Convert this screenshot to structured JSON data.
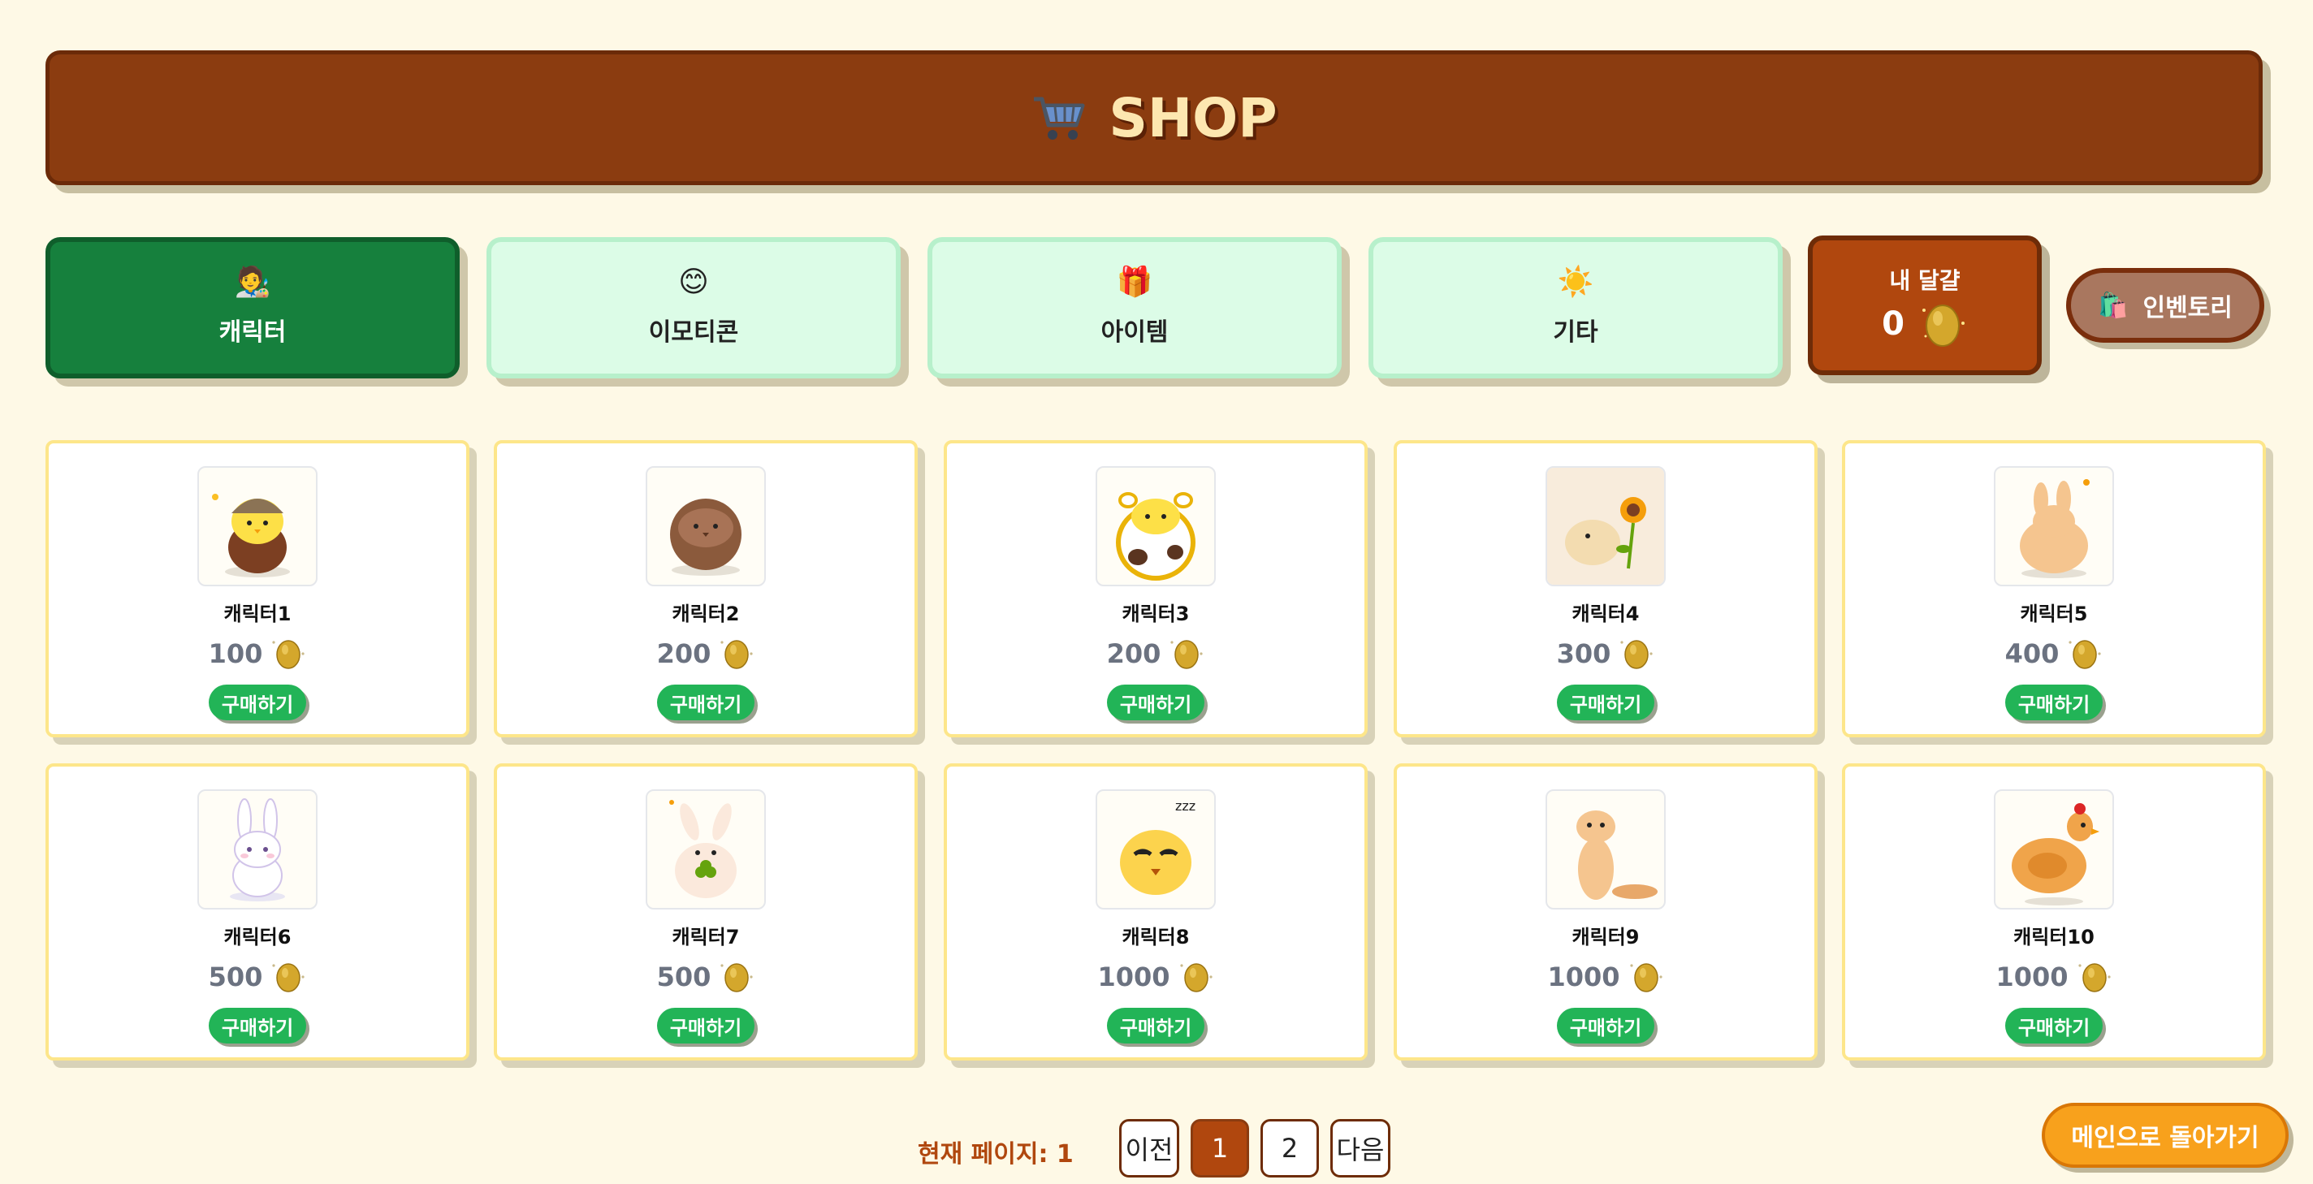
{
  "header": {
    "title": "SHOP",
    "icon": "shopping-cart-icon"
  },
  "tabs": [
    {
      "label": "캐릭터",
      "icon": "🧑‍🎨",
      "active": true
    },
    {
      "label": "이모티콘",
      "icon": "😊",
      "active": false
    },
    {
      "label": "아이템",
      "icon": "🎁",
      "active": false
    },
    {
      "label": "기타",
      "icon": "☀️",
      "active": false
    }
  ],
  "wallet": {
    "label": "내 달걀",
    "count": "0",
    "icon": "golden-egg-icon"
  },
  "inventory": {
    "label": "인벤토리",
    "icon": "🛍️"
  },
  "products": [
    {
      "name": "캐릭터1",
      "price": "100",
      "buy_label": "구매하기"
    },
    {
      "name": "캐릭터2",
      "price": "200",
      "buy_label": "구매하기"
    },
    {
      "name": "캐릭터3",
      "price": "200",
      "buy_label": "구매하기"
    },
    {
      "name": "캐릭터4",
      "price": "300",
      "buy_label": "구매하기"
    },
    {
      "name": "캐릭터5",
      "price": "400",
      "buy_label": "구매하기"
    },
    {
      "name": "캐릭터6",
      "price": "500",
      "buy_label": "구매하기"
    },
    {
      "name": "캐릭터7",
      "price": "500",
      "buy_label": "구매하기"
    },
    {
      "name": "캐릭터8",
      "price": "1000",
      "buy_label": "구매하기"
    },
    {
      "name": "캐릭터9",
      "price": "1000",
      "buy_label": "구매하기"
    },
    {
      "name": "캐릭터10",
      "price": "1000",
      "buy_label": "구매하기"
    }
  ],
  "pagination": {
    "current_label": "현재 페이지: 1",
    "prev_label": "이전",
    "pages": [
      "1",
      "2"
    ],
    "next_label": "다음",
    "current_page": 1
  },
  "back_button": {
    "label": "메인으로 돌아가기"
  },
  "colors": {
    "background": "#fef9e6",
    "header": "#8b3c10",
    "tab_active": "#16803d",
    "tab_inactive": "#dcfce7",
    "wallet": "#b0470e",
    "buy_button": "#22b457",
    "back_button": "#f8a11c"
  }
}
